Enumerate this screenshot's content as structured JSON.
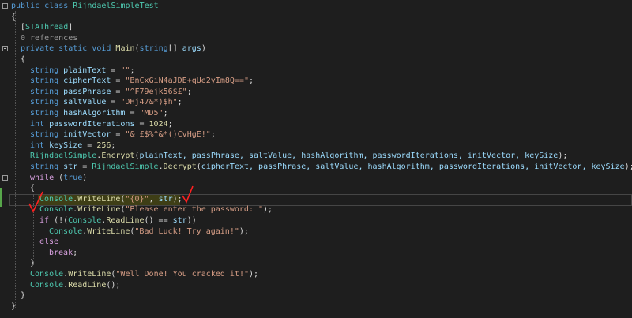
{
  "colors": {
    "background": "#1e1e1e",
    "keyword": "#569cd6",
    "type": "#4ec9b0",
    "string": "#d69d85",
    "method": "#dcdcaa",
    "control": "#d8a0df",
    "identifier": "#9cdcfe",
    "annotation": "#ff2020"
  },
  "lines": [
    {
      "indent": 0,
      "fold": true,
      "tokens": [
        {
          "t": "public class ",
          "c": "kw"
        },
        {
          "t": "RijndaelSimpleTest",
          "c": "ty"
        }
      ]
    },
    {
      "indent": 0,
      "tokens": [
        {
          "t": "{",
          "c": "pl"
        }
      ]
    },
    {
      "indent": 1,
      "tokens": [
        {
          "t": "[",
          "c": "pl"
        },
        {
          "t": "STAThread",
          "c": "ty"
        },
        {
          "t": "]",
          "c": "pl"
        }
      ]
    },
    {
      "indent": 1,
      "tokens": [
        {
          "t": "0 references",
          "c": "ref"
        }
      ]
    },
    {
      "indent": 1,
      "fold": true,
      "tokens": [
        {
          "t": "private static void ",
          "c": "kw"
        },
        {
          "t": "Main",
          "c": "me"
        },
        {
          "t": "(",
          "c": "pl"
        },
        {
          "t": "string",
          "c": "kw"
        },
        {
          "t": "[] ",
          "c": "pl"
        },
        {
          "t": "args",
          "c": "va"
        },
        {
          "t": ")",
          "c": "pl"
        }
      ]
    },
    {
      "indent": 1,
      "tokens": [
        {
          "t": "{",
          "c": "pl"
        }
      ]
    },
    {
      "indent": 2,
      "tokens": [
        {
          "t": "string ",
          "c": "kw"
        },
        {
          "t": "plainText",
          "c": "va"
        },
        {
          "t": " = ",
          "c": "pl"
        },
        {
          "t": "\"\"",
          "c": "st"
        },
        {
          "t": ";",
          "c": "pl"
        }
      ]
    },
    {
      "indent": 2,
      "tokens": [
        {
          "t": "string ",
          "c": "kw"
        },
        {
          "t": "cipherText",
          "c": "va"
        },
        {
          "t": " = ",
          "c": "pl"
        },
        {
          "t": "\"BnCxGiN4aJDE+qUe2yIm8Q==\"",
          "c": "st"
        },
        {
          "t": ";",
          "c": "pl"
        }
      ]
    },
    {
      "indent": 2,
      "tokens": [
        {
          "t": "string ",
          "c": "kw"
        },
        {
          "t": "passPhrase",
          "c": "va"
        },
        {
          "t": " = ",
          "c": "pl"
        },
        {
          "t": "\"^F79ejk56$£\"",
          "c": "st"
        },
        {
          "t": ";",
          "c": "pl"
        }
      ]
    },
    {
      "indent": 2,
      "tokens": [
        {
          "t": "string ",
          "c": "kw"
        },
        {
          "t": "saltValue",
          "c": "va"
        },
        {
          "t": " = ",
          "c": "pl"
        },
        {
          "t": "\"DHj47&*)$h\"",
          "c": "st"
        },
        {
          "t": ";",
          "c": "pl"
        }
      ]
    },
    {
      "indent": 2,
      "tokens": [
        {
          "t": "string ",
          "c": "kw"
        },
        {
          "t": "hashAlgorithm",
          "c": "va"
        },
        {
          "t": " = ",
          "c": "pl"
        },
        {
          "t": "\"MD5\"",
          "c": "st"
        },
        {
          "t": ";",
          "c": "pl"
        }
      ]
    },
    {
      "indent": 2,
      "tokens": [
        {
          "t": "int ",
          "c": "kw"
        },
        {
          "t": "passwordIterations",
          "c": "va"
        },
        {
          "t": " = ",
          "c": "pl"
        },
        {
          "t": "1024",
          "c": "me"
        },
        {
          "t": ";",
          "c": "pl"
        }
      ]
    },
    {
      "indent": 2,
      "tokens": [
        {
          "t": "string ",
          "c": "kw"
        },
        {
          "t": "initVector",
          "c": "va"
        },
        {
          "t": " = ",
          "c": "pl"
        },
        {
          "t": "\"&!£$%^&*()CvHgE!\"",
          "c": "st"
        },
        {
          "t": ";",
          "c": "pl"
        }
      ]
    },
    {
      "indent": 2,
      "tokens": [
        {
          "t": "int ",
          "c": "kw"
        },
        {
          "t": "keySize",
          "c": "va"
        },
        {
          "t": " = ",
          "c": "pl"
        },
        {
          "t": "256",
          "c": "me"
        },
        {
          "t": ";",
          "c": "pl"
        }
      ]
    },
    {
      "indent": 2,
      "tokens": [
        {
          "t": "RijndaelSimple",
          "c": "ty"
        },
        {
          "t": ".",
          "c": "pl"
        },
        {
          "t": "Encrypt",
          "c": "me"
        },
        {
          "t": "(",
          "c": "pl"
        },
        {
          "t": "plainText, passPhrase, saltValue, hashAlgorithm, passwordIterations, initVector, keySize",
          "c": "va"
        },
        {
          "t": ");",
          "c": "pl"
        }
      ]
    },
    {
      "indent": 2,
      "tokens": [
        {
          "t": "string ",
          "c": "kw"
        },
        {
          "t": "str",
          "c": "va"
        },
        {
          "t": " = ",
          "c": "pl"
        },
        {
          "t": "RijndaelSimple",
          "c": "ty"
        },
        {
          "t": ".",
          "c": "pl"
        },
        {
          "t": "Decrypt",
          "c": "me"
        },
        {
          "t": "(",
          "c": "pl"
        },
        {
          "t": "cipherText, passPhrase, saltValue, hashAlgorithm, passwordIterations, initVector, keySize",
          "c": "va"
        },
        {
          "t": ");",
          "c": "pl"
        }
      ]
    },
    {
      "indent": 2,
      "fold": true,
      "tokens": [
        {
          "t": "while",
          "c": "ct"
        },
        {
          "t": " (",
          "c": "pl"
        },
        {
          "t": "true",
          "c": "kw"
        },
        {
          "t": ")",
          "c": "pl"
        }
      ]
    },
    {
      "indent": 2,
      "tokens": [
        {
          "t": "{",
          "c": "pl"
        }
      ]
    },
    {
      "indent": 3,
      "tokens": [
        {
          "t": "Console",
          "c": "ty"
        },
        {
          "t": ".",
          "c": "pl"
        },
        {
          "t": "WriteLine",
          "c": "me"
        },
        {
          "t": "(",
          "c": "pl"
        },
        {
          "t": "\"{0}\"",
          "c": "st"
        },
        {
          "t": ", ",
          "c": "pl"
        },
        {
          "t": "str",
          "c": "va"
        },
        {
          "t": ");",
          "c": "pl"
        }
      ]
    },
    {
      "indent": 3,
      "tokens": [
        {
          "t": "Console",
          "c": "ty"
        },
        {
          "t": ".",
          "c": "pl"
        },
        {
          "t": "WriteLine",
          "c": "me"
        },
        {
          "t": "(",
          "c": "pl"
        },
        {
          "t": "\"Please enter the password: \"",
          "c": "st"
        },
        {
          "t": ");",
          "c": "pl"
        }
      ]
    },
    {
      "indent": 3,
      "tokens": [
        {
          "t": "if",
          "c": "ct"
        },
        {
          "t": " (!(",
          "c": "pl"
        },
        {
          "t": "Console",
          "c": "ty"
        },
        {
          "t": ".",
          "c": "pl"
        },
        {
          "t": "ReadLine",
          "c": "me"
        },
        {
          "t": "() == ",
          "c": "pl"
        },
        {
          "t": "str",
          "c": "va"
        },
        {
          "t": "))",
          "c": "pl"
        }
      ]
    },
    {
      "indent": 4,
      "tokens": [
        {
          "t": "Console",
          "c": "ty"
        },
        {
          "t": ".",
          "c": "pl"
        },
        {
          "t": "WriteLine",
          "c": "me"
        },
        {
          "t": "(",
          "c": "pl"
        },
        {
          "t": "\"Bad Luck! Try again!\"",
          "c": "st"
        },
        {
          "t": ");",
          "c": "pl"
        }
      ]
    },
    {
      "indent": 3,
      "tokens": [
        {
          "t": "else",
          "c": "ct"
        }
      ]
    },
    {
      "indent": 4,
      "tokens": [
        {
          "t": "break",
          "c": "ct"
        },
        {
          "t": ";",
          "c": "pl"
        }
      ]
    },
    {
      "indent": 2,
      "tokens": [
        {
          "t": "}",
          "c": "pl"
        }
      ]
    },
    {
      "indent": 2,
      "tokens": [
        {
          "t": "Console",
          "c": "ty"
        },
        {
          "t": ".",
          "c": "pl"
        },
        {
          "t": "WriteLine",
          "c": "me"
        },
        {
          "t": "(",
          "c": "pl"
        },
        {
          "t": "\"Well Done! You cracked it!\"",
          "c": "st"
        },
        {
          "t": ");",
          "c": "pl"
        }
      ]
    },
    {
      "indent": 2,
      "tokens": [
        {
          "t": "Console",
          "c": "ty"
        },
        {
          "t": ".",
          "c": "pl"
        },
        {
          "t": "ReadLine",
          "c": "me"
        },
        {
          "t": "();",
          "c": "pl"
        }
      ]
    },
    {
      "indent": 1,
      "tokens": [
        {
          "t": "}",
          "c": "pl"
        }
      ]
    },
    {
      "indent": 0,
      "tokens": [
        {
          "t": "}",
          "c": "pl"
        }
      ]
    }
  ]
}
